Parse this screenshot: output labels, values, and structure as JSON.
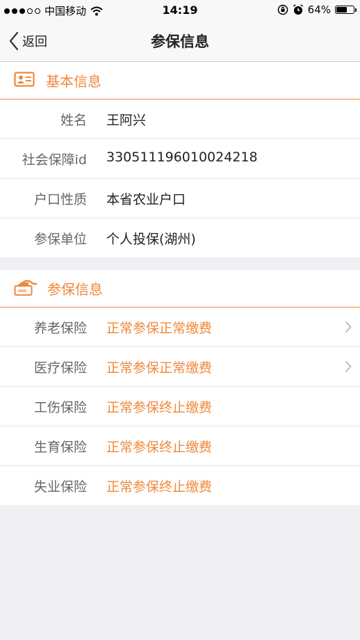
{
  "status_bar": {
    "carrier": "中国移动",
    "time": "14:19",
    "battery_percent": "64%",
    "battery_level": 0.64,
    "signal_filled": 3,
    "signal_total": 5
  },
  "nav": {
    "back_label": "返回",
    "title": "参保信息"
  },
  "basic_info": {
    "title": "基本信息",
    "icon": "id-card-icon",
    "rows": [
      {
        "label": "姓名",
        "value": "王阿兴"
      },
      {
        "label": "社会保障id",
        "value": "330511196010024218"
      },
      {
        "label": "户口性质",
        "value": "本省农业户口"
      },
      {
        "label": "参保单位",
        "value": "个人投保(湖州)"
      }
    ]
  },
  "insurance_info": {
    "title": "参保信息",
    "icon": "money-hand-icon",
    "rows": [
      {
        "label": "养老保险",
        "value": "正常参保正常缴费",
        "has_chevron": true
      },
      {
        "label": "医疗保险",
        "value": "正常参保正常缴费",
        "has_chevron": true
      },
      {
        "label": "工伤保险",
        "value": "正常参保终止缴费",
        "has_chevron": false
      },
      {
        "label": "生育保险",
        "value": "正常参保终止缴费",
        "has_chevron": false
      },
      {
        "label": "失业保险",
        "value": "正常参保终止缴费",
        "has_chevron": false
      }
    ]
  },
  "colors": {
    "accent": "#f0883a",
    "background": "#efeff4"
  }
}
